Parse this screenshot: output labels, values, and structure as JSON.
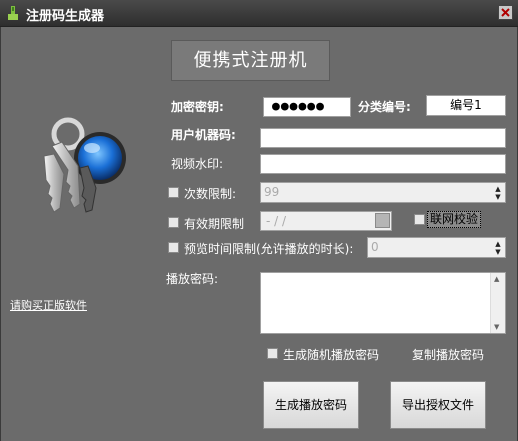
{
  "window": {
    "title": "注册码生成器"
  },
  "banner": {
    "label": "便携式注册机"
  },
  "form": {
    "key_label": "加密密钥:",
    "key_value": "●●●●●●",
    "category_label": "分类编号:",
    "category_value": "编号1",
    "machine_code_label": "用户机器码:",
    "machine_code_value": "",
    "watermark_label": "视频水印:",
    "watermark_value": "",
    "count_limit_label": "次数限制:",
    "count_limit_value": "99",
    "expiry_label": "有效期限制",
    "expiry_value": "- / /",
    "net_check_label": "联网校验",
    "preview_label": "预览时间限制(允许播放的时长):",
    "preview_value": "0",
    "play_password_label": "播放密码:",
    "play_password_value": ""
  },
  "options": {
    "random_password_label": "生成随机播放密码",
    "copy_password_label": "复制播放密码"
  },
  "buttons": {
    "generate_label": "生成播放密码",
    "export_label": "导出授权文件"
  },
  "links": {
    "buy_label": "请购买正版软件"
  },
  "icons": {
    "app": "app-icon",
    "close": "close-icon",
    "keys": "keys-icon"
  }
}
